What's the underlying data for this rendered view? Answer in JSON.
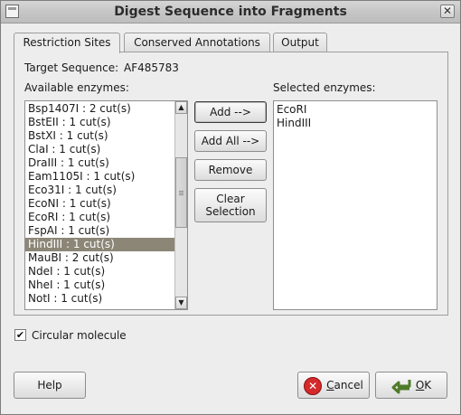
{
  "window": {
    "title": "Digest Sequence into Fragments"
  },
  "tabs": [
    {
      "label": "Restriction Sites",
      "active": true
    },
    {
      "label": "Conserved Annotations",
      "active": false
    },
    {
      "label": "Output",
      "active": false
    }
  ],
  "target": {
    "label": "Target Sequence:",
    "value": "AF485783"
  },
  "available": {
    "label": "Available enzymes:",
    "items": [
      "Bsp1407I : 2 cut(s)",
      "BstEII : 1 cut(s)",
      "BstXI : 1 cut(s)",
      "ClaI : 1 cut(s)",
      "DraIII : 1 cut(s)",
      "Eam1105I : 1 cut(s)",
      "Eco31I : 1 cut(s)",
      "EcoNI : 1 cut(s)",
      "EcoRI : 1 cut(s)",
      "FspAI : 1 cut(s)",
      "HindIII : 1 cut(s)",
      "MauBI : 2 cut(s)",
      "NdeI : 1 cut(s)",
      "NheI : 1 cut(s)",
      "NotI : 1 cut(s)"
    ],
    "selected_item": "HindIII : 1 cut(s)"
  },
  "actions": {
    "add": "Add -->",
    "add_all": "Add All -->",
    "remove": "Remove",
    "clear_line1": "Clear",
    "clear_line2": "Selection"
  },
  "selected": {
    "label": "Selected enzymes:",
    "items": [
      "EcoRI",
      "HindIII"
    ]
  },
  "circular": {
    "label": "Circular molecule",
    "checked": true
  },
  "footer": {
    "help": "Help",
    "cancel_mnemonic": "C",
    "cancel_rest": "ancel",
    "ok_mnemonic": "O",
    "ok_rest": "K"
  }
}
